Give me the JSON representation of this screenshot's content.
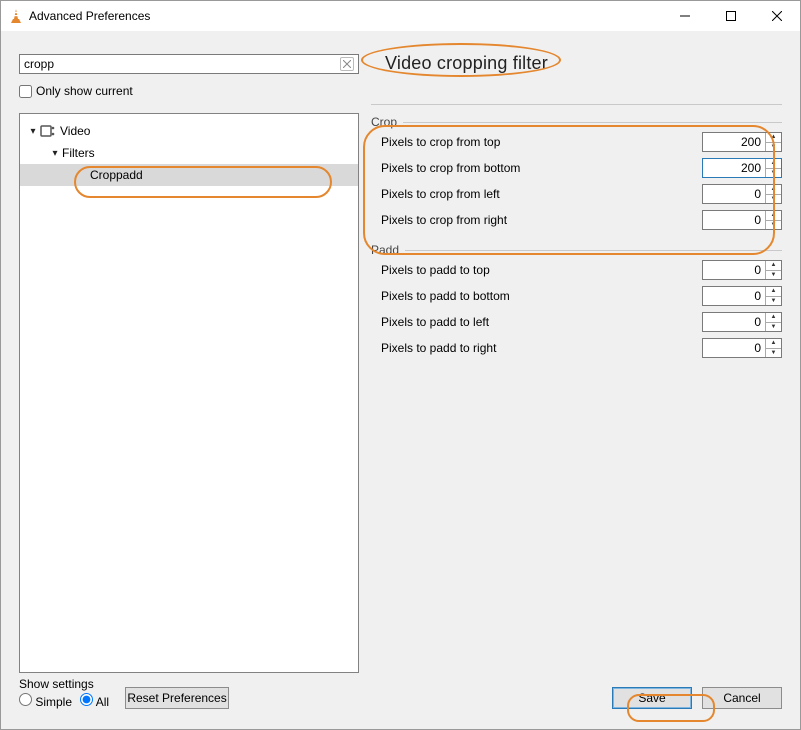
{
  "window": {
    "title": "Advanced Preferences"
  },
  "search": {
    "value": "cropp",
    "only_show_current": "Only show current"
  },
  "panel_title": "Video cropping filter",
  "tree": {
    "video": "Video",
    "filters": "Filters",
    "croppadd": "Croppadd"
  },
  "groups": {
    "crop": {
      "title": "Crop",
      "fields": [
        {
          "label": "Pixels to crop from top",
          "value": "200"
        },
        {
          "label": "Pixels to crop from bottom",
          "value": "200"
        },
        {
          "label": "Pixels to crop from left",
          "value": "0"
        },
        {
          "label": "Pixels to crop from right",
          "value": "0"
        }
      ]
    },
    "padd": {
      "title": "Padd",
      "fields": [
        {
          "label": "Pixels to padd to top",
          "value": "0"
        },
        {
          "label": "Pixels to padd to bottom",
          "value": "0"
        },
        {
          "label": "Pixels to padd to left",
          "value": "0"
        },
        {
          "label": "Pixels to padd to right",
          "value": "0"
        }
      ]
    }
  },
  "footer": {
    "show_settings": "Show settings",
    "simple": "Simple",
    "all": "All",
    "reset": "Reset Preferences",
    "save": "Save",
    "cancel": "Cancel"
  }
}
